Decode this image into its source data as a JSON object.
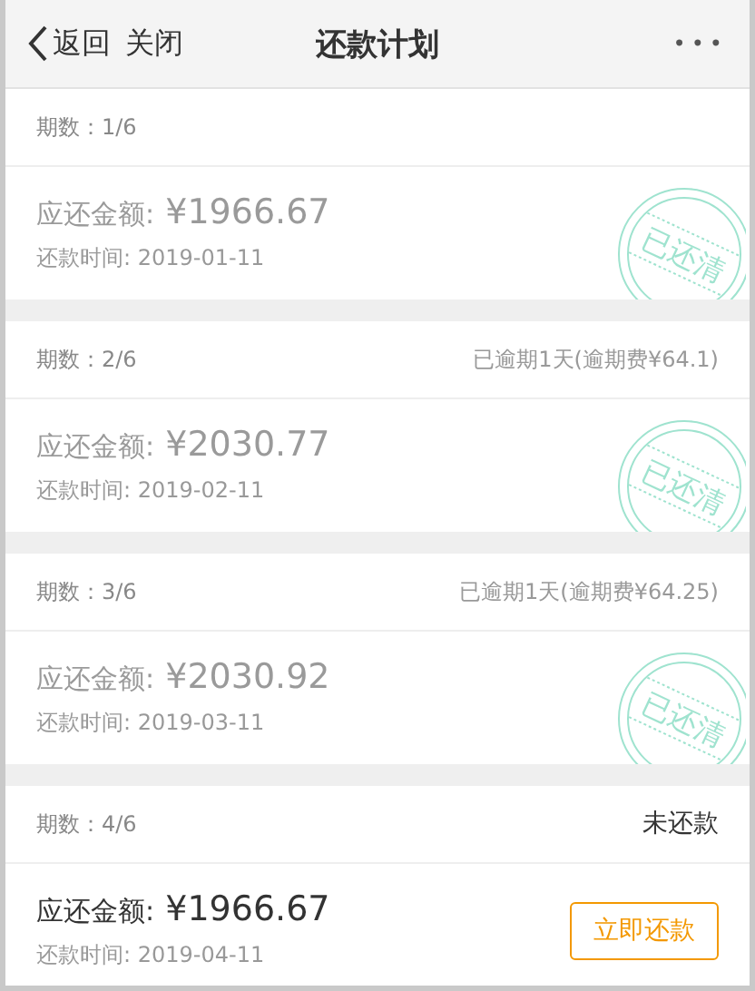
{
  "nav": {
    "back": "返回",
    "close": "关闭",
    "title": "还款计划",
    "more": "•••"
  },
  "periods": [
    {
      "period_label": "期数：1/6",
      "amount_label": "应还金额:",
      "amount": "¥1966.67",
      "date_label": "还款时间: 2019-01-11",
      "paid": true,
      "stamp": "已还清"
    },
    {
      "period_label": "期数：2/6",
      "status": "已逾期1天(逾期费¥64.1)",
      "kind": "overdue",
      "amount_label": "应还金额:",
      "amount": "¥2030.77",
      "date_label": "还款时间: 2019-02-11",
      "paid": true,
      "stamp": "已还清"
    },
    {
      "period_label": "期数：3/6",
      "status": "已逾期1天(逾期费¥64.25)",
      "kind": "overdue",
      "amount_label": "应还金额:",
      "amount": "¥2030.92",
      "date_label": "还款时间: 2019-03-11",
      "paid": true,
      "stamp": "已还清"
    },
    {
      "period_label": "期数：4/6",
      "status": "未还款",
      "kind": "unpaid",
      "amount_label": "应还金额:",
      "amount": "¥1966.67",
      "date_label": "还款时间: 2019-04-11",
      "paid": false,
      "action": "立即还款"
    }
  ]
}
